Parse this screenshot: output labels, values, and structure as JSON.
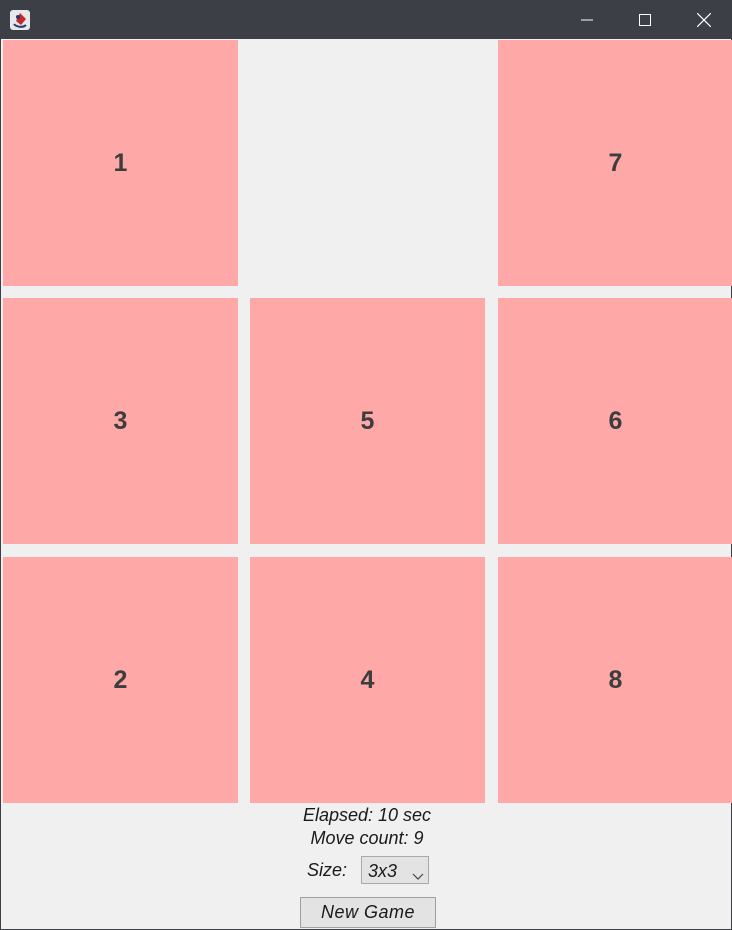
{
  "window": {
    "title_icon": "java-app-icon",
    "controls": {
      "minimize_icon": "minimize-icon",
      "maximize_icon": "maximize-icon",
      "close_icon": "close-icon"
    },
    "titlebar_color": "#3c3f46"
  },
  "board": {
    "tile_color": "#ffa8a8",
    "background_color": "#f0f0f0",
    "tiles": [
      {
        "label": "1",
        "empty": false
      },
      {
        "label": "",
        "empty": true
      },
      {
        "label": "7",
        "empty": false
      },
      {
        "label": "3",
        "empty": false
      },
      {
        "label": "5",
        "empty": false
      },
      {
        "label": "6",
        "empty": false
      },
      {
        "label": "2",
        "empty": false
      },
      {
        "label": "4",
        "empty": false
      },
      {
        "label": "8",
        "empty": false
      }
    ]
  },
  "status": {
    "elapsed": "Elapsed: 10 sec",
    "moves": "Move count: 9"
  },
  "controls": {
    "size_label": "Size:",
    "size_value": "3x3",
    "new_game_label": "New Game"
  }
}
